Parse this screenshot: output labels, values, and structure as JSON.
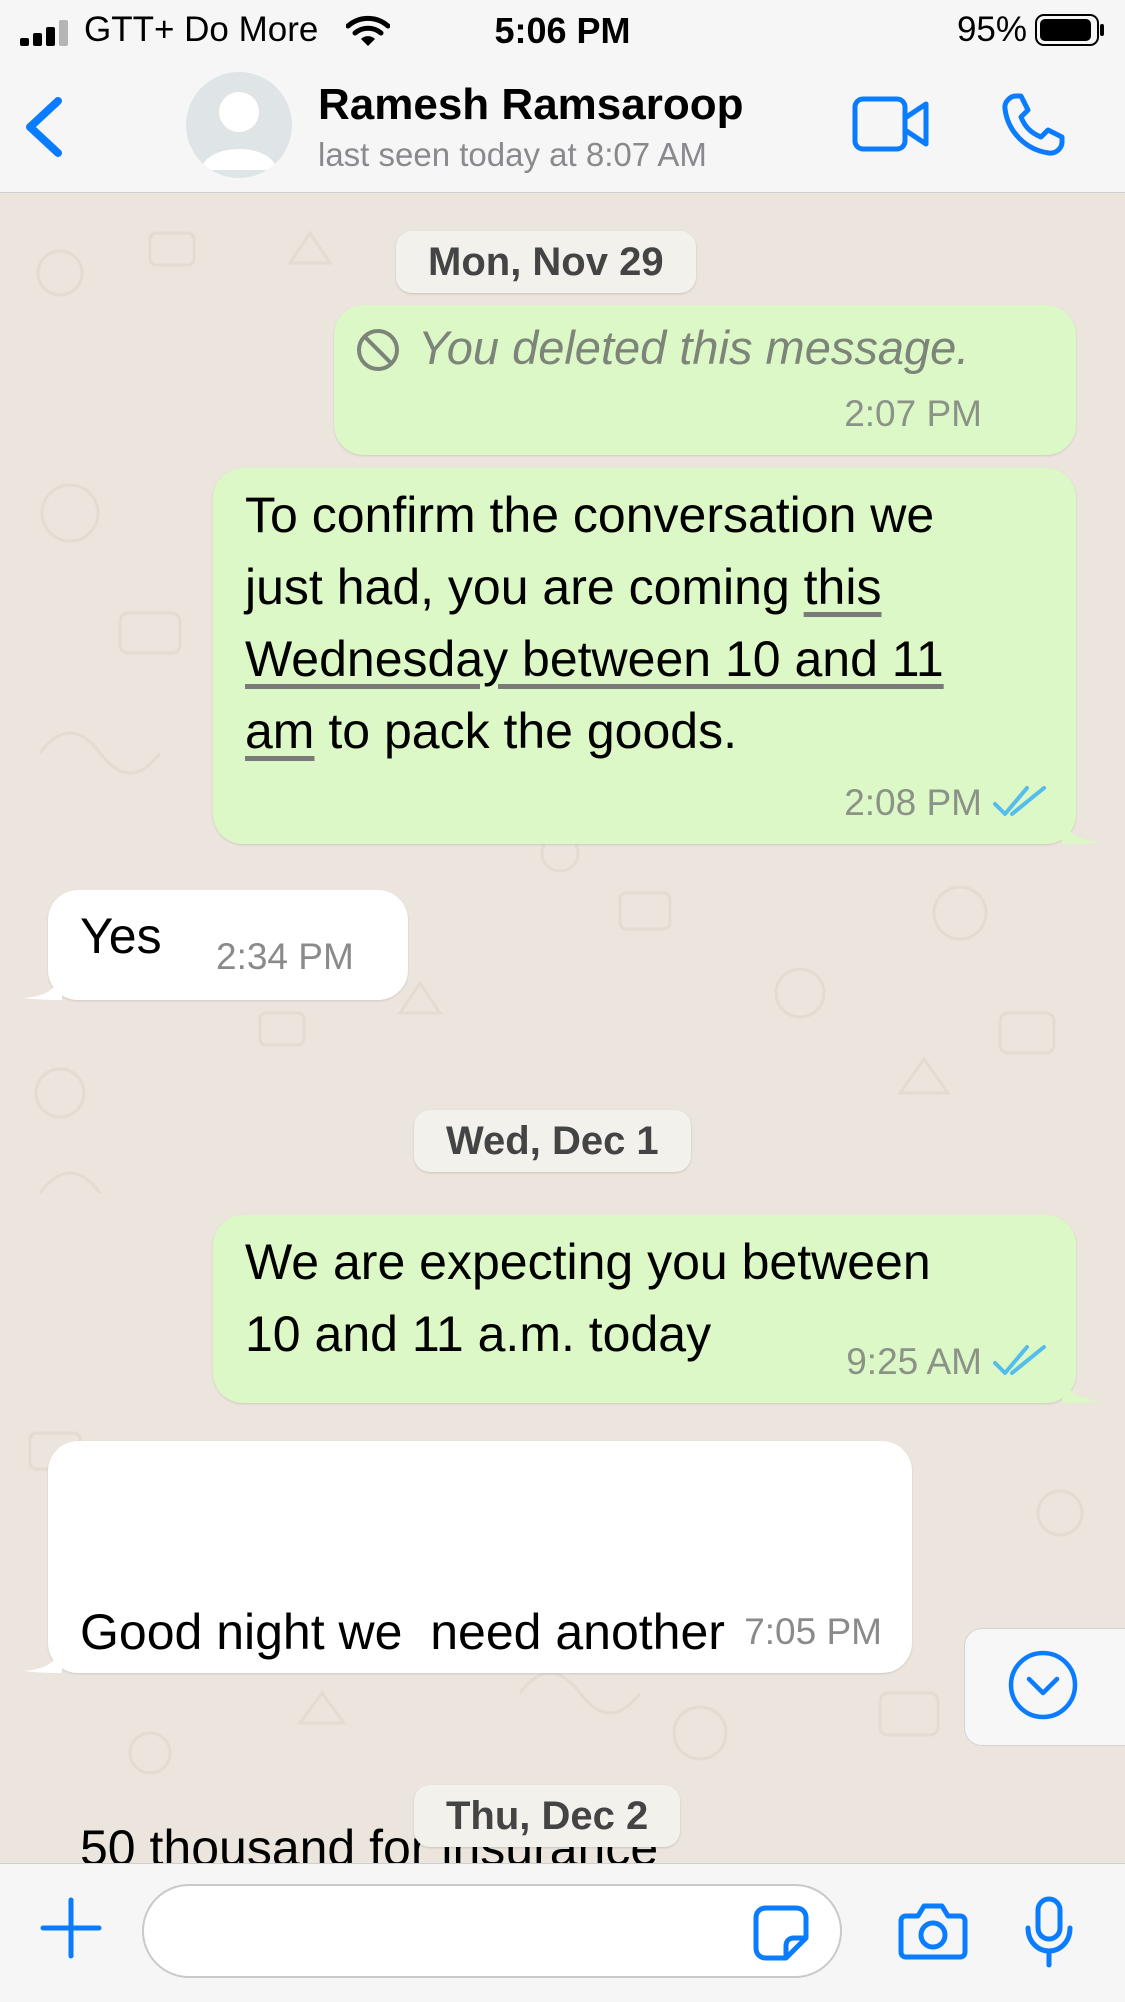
{
  "status_bar": {
    "carrier": "GTT+ Do More",
    "time": "5:06 PM",
    "battery_percent": "95%",
    "battery_level": 0.95,
    "signal_bars": 3
  },
  "header": {
    "contact_name": "Ramesh Ramsaroop",
    "status": "last seen today at 8:07 AM"
  },
  "chat": {
    "date_1": "Mon, Nov 29",
    "deleted_message": {
      "text": "You deleted this message.",
      "time": "2:07 PM"
    },
    "msg_confirm": {
      "line1": "To confirm the conversation we",
      "line2_plain": "just had, you are coming ",
      "line2_link": "this",
      "line3_link": "Wednesday between 10 and 11",
      "line4_link": "am",
      "line4_plain": " to pack the goods.",
      "time": "2:08 PM",
      "status": "read"
    },
    "msg_yes": {
      "text": "Yes",
      "time": "2:34 PM"
    },
    "date_2": "Wed, Dec 1",
    "msg_expecting": {
      "line1": "We are expecting you between",
      "line2": "10 and 11 a.m. today",
      "time": "9:25 AM",
      "status": "read"
    },
    "msg_goodnight": {
      "line1": "Good night we  need another",
      "line2": "50 thousand for insurance",
      "time": "7:05 PM"
    },
    "date_3": "Thu, Dec 2"
  },
  "input": {
    "placeholder": ""
  },
  "colors": {
    "accent": "#0a7cff",
    "outgoing_bubble": "#dcf8c6",
    "incoming_bubble": "#ffffff",
    "read_ticks": "#53bdeb",
    "chat_background": "#ece5dd"
  },
  "icons": [
    "signal-icon",
    "wifi-icon",
    "battery-icon",
    "back-icon",
    "avatar-icon",
    "video-call-icon",
    "phone-icon",
    "deleted-icon",
    "read-ticks-icon",
    "chevron-down-icon",
    "plus-icon",
    "sticker-icon",
    "camera-icon",
    "microphone-icon"
  ]
}
